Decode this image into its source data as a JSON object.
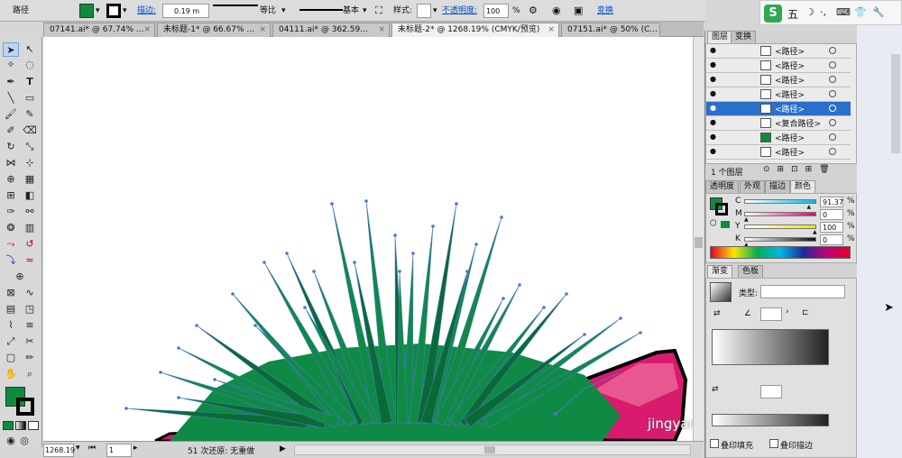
{
  "control_bar": {
    "object_type": "路径",
    "stroke_label": "描边:",
    "stroke_weight": "0.19 m",
    "profile_label": "等比",
    "brush_label": "基本",
    "style_label": "样式:",
    "opacity_label": "不透明度:",
    "opacity_value": "100",
    "opacity_unit": "%",
    "transform_label": "变换",
    "fill_color": "#0e8c3e",
    "stroke_color": "#000000"
  },
  "tabs": [
    {
      "label": "07141.ai* @ 67.74% ...",
      "active": false
    },
    {
      "label": "未标题-1* @ 66.67% ...",
      "active": false
    },
    {
      "label": "04111.ai* @ 362.59...",
      "active": false
    },
    {
      "label": "未标题-2* @ 1268.19% (CMYK/预览)",
      "active": true
    },
    {
      "label": "07151.ai* @ 50% (C...",
      "active": false
    }
  ],
  "status": {
    "zoom": "1268.19",
    "artboard": "1",
    "undo_text": "51 次还原: 无重做"
  },
  "layers_panel": {
    "tabs": [
      "图层",
      "变换"
    ],
    "items": [
      {
        "name": "<路径>",
        "selected": false
      },
      {
        "name": "<路径>",
        "selected": false
      },
      {
        "name": "<路径>",
        "selected": false
      },
      {
        "name": "<路径>",
        "selected": false
      },
      {
        "name": "<路径>",
        "selected": true
      },
      {
        "name": "<复合路径>",
        "selected": false
      },
      {
        "name": "<路径>",
        "selected": false
      },
      {
        "name": "<路径>",
        "selected": false
      }
    ],
    "footer": "1 个图层"
  },
  "color_panel": {
    "tabs": [
      "透明度",
      "外观",
      "描边",
      "颜色"
    ],
    "channels": [
      {
        "label": "C",
        "value": "91.37",
        "unit": "%",
        "level": 0.9137,
        "color": "#00b8e6"
      },
      {
        "label": "M",
        "value": "0",
        "unit": "%",
        "level": 0,
        "color": "#e0007a"
      },
      {
        "label": "Y",
        "value": "100",
        "unit": "%",
        "level": 1,
        "color": "#f5e400"
      },
      {
        "label": "K",
        "value": "0",
        "unit": "%",
        "level": 0,
        "color": "#111111"
      }
    ],
    "fill_color": "#0e8c3e"
  },
  "gradient_panel": {
    "tabs": [
      "渐变",
      "色板"
    ],
    "type_label": "类型:",
    "overprint_fill": "叠印填充",
    "overprint_stroke": "叠印描边"
  },
  "ime": {
    "label": "五"
  },
  "watermark": "jingyan.baidu.com",
  "colors": {
    "grass": "#0f8a45",
    "grass_dark": "#0a6a34",
    "grass_tip": "#4a78c8",
    "rock": "#d81b6e",
    "rock_light": "#e8578f"
  }
}
